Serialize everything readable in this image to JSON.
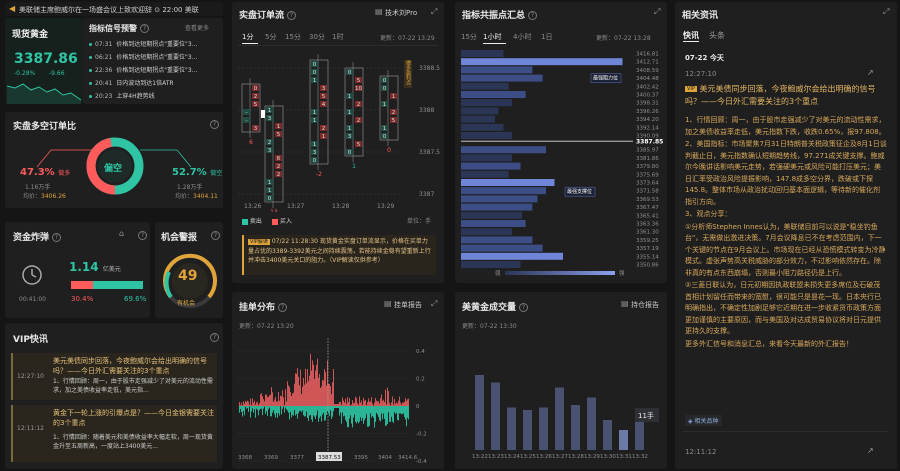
{
  "ticker": {
    "text": "美联储主席鲍威尔在一场盛会议上致欢迎辞 ⊙ 22:00 美联"
  },
  "gold": {
    "title": "现货黄金",
    "price": "3387.86",
    "change": "-0.28%",
    "change_abs": "-9.66"
  },
  "signals": {
    "title": "指标信号预警",
    "more": "查看更多",
    "items": [
      {
        "time": "07:31",
        "text": "价格到达短期拐点\"重要位\"3..."
      },
      {
        "time": "06:21",
        "text": "价格到达短期拐点\"重要位\"3..."
      },
      {
        "time": "22:36",
        "text": "价格到达短期拐点\"重要位\"3..."
      },
      {
        "time": "20:41",
        "text": "日内波动到达1倍ATR"
      },
      {
        "time": "20:23",
        "text": "上穿4H趋势线"
      }
    ]
  },
  "position": {
    "title": "实盘多空订单比",
    "center": "偏空",
    "left_pct": "47.3%",
    "left_label": "做多",
    "left_amt": "1.16万手",
    "left_avg_label": "均价：",
    "left_avg": "3406.26",
    "right_pct": "52.7%",
    "right_label": "做空",
    "right_amt": "1.28万手",
    "right_avg_label": "均价：",
    "right_avg": "3404.11"
  },
  "bomb": {
    "title": "资金炸弹",
    "value": "1.14",
    "unit": "亿美元",
    "timer": "00:41:00",
    "red_pct": "30.4%",
    "green_pct": "69.6%",
    "red_frac": 0.304
  },
  "alert": {
    "title": "机会警报",
    "score": "49",
    "label": "有机会"
  },
  "vip_news": {
    "title": "VIP快讯",
    "items": [
      {
        "time": "12:27:10",
        "text": "美元美债同步回落，今夜鲍威尔会给出明确的信号吗？——今日外汇需要关注的3个重点",
        "body": "1、行情回顾：周一，由于股市走强减少了对美元的流动性需求，加之美债收益率走低，美元指..."
      },
      {
        "time": "12:11:12",
        "text": "黄金下一轮上涨的引爆点是？——今日金银需要关注的3个重点",
        "body": "1、行情回顾：随着美元和美债收益率大幅走软，周一现货黄金升至五周新高，一度站上3400美元..."
      }
    ]
  },
  "orderflow": {
    "title": "实盘订单流",
    "link": "技术刘Pro",
    "tabs": [
      "1分",
      "5分",
      "15分",
      "30分",
      "1时"
    ],
    "updated": "更新：07-22 13:29",
    "prices": [
      "3388.5",
      "3388",
      "3387.5",
      "3387"
    ],
    "times": [
      "13:26",
      "13:27",
      "13:28",
      "13:29"
    ],
    "legend_sell": "卖出",
    "legend_buy": "买入",
    "unit_label": "单位：手",
    "delta_labels": [
      "6",
      "13",
      "-2",
      "1",
      "0"
    ],
    "side_label": "做多盈利点",
    "cols": [
      [
        "0",
        "2",
        "5",
        "-",
        "-",
        "3"
      ],
      [
        "1",
        "3",
        "1",
        "5",
        "2",
        "3",
        "6",
        "2",
        "2",
        "1",
        "1",
        "0"
      ],
      [
        "0",
        "0",
        "1",
        "3",
        "5",
        "4",
        "1",
        "1",
        "2",
        "1",
        "1",
        "3",
        "0"
      ],
      [
        "0",
        "5",
        "10",
        "1",
        "2",
        "1",
        "2",
        "1",
        "3",
        "5",
        "0"
      ],
      [
        "0",
        "0",
        "1",
        "1",
        "2",
        "5",
        "1",
        "0"
      ]
    ],
    "note_tag": "VIP解读",
    "note": "07/22 11:28:30 现货黄金实盘订单流显示，价格在买单力量占优的3389-3392美元之间持续震荡，若能持续金稳有望重新上行并冲击3400美元关口的阻力。（VIP解读仅供参考）"
  },
  "resonance": {
    "title": "指标共振点汇总",
    "tabs": [
      "15分",
      "1小时",
      "4小时",
      "1日"
    ],
    "updated": "更新：07-22 13:28",
    "current": "3387.85",
    "resist_label": "最强阻力位",
    "support_label": "最强支撑位",
    "legend_weak": "弱",
    "legend_strong": "强",
    "levels": [
      "3416.81",
      "3412.71",
      "3408.59",
      "3404.48",
      "3402.42",
      "3400.37",
      "3398.31",
      "3396.26",
      "3394.20",
      "3392.14",
      "3390.09",
      "3385.97",
      "3381.86",
      "3379.80",
      "3375.69",
      "3373.64",
      "3371.58",
      "3369.53",
      "3367.47",
      "3365.41",
      "3363.36",
      "3361.30",
      "3359.25",
      "3357.19",
      "3355.14",
      "3350.86"
    ],
    "values": [
      0.25,
      0.95,
      0.42,
      0.48,
      0.28,
      0.38,
      0.3,
      0.22,
      0.2,
      0.25,
      0.3,
      0.5,
      0.3,
      0.35,
      0.28,
      0.55,
      0.5,
      0.45,
      0.42,
      0.36,
      0.38,
      0.3,
      0.42,
      0.48,
      0.6,
      0.35
    ],
    "strength": [
      1,
      3,
      2,
      2,
      1,
      2,
      1,
      1,
      1,
      1,
      1,
      2,
      1,
      2,
      1,
      3,
      2,
      2,
      2,
      1,
      2,
      1,
      2,
      2,
      3,
      1
    ]
  },
  "news": {
    "title": "相关资讯",
    "tabs": [
      "快讯",
      "头条"
    ],
    "date": "07-22 今天",
    "items": [
      {
        "time": "12:27:10",
        "vip": "VIP",
        "title": "美元美债同步回落，今夜鲍威尔会给出明确的信号吗？——今日外汇需要关注的3个重点",
        "body": [
          "1、行情回顾：周一，由于股市走强减少了对美元的流动性需求，加之美债收益率走低，美元指数下跌，收跌0.65%，报97.808。",
          "2、美国指标：市场聚焦7月31日特朗普关税政策征企及8月1日谈判截止日，美元指数确认短期趋势线，97.271成关键支撑。鲍威尔今晚讲话影响美元走势，若强硬美元或风险可能打压美元；美日汇率受政治风险提振影响，147.8成多空分界，跌破或下探145.8。整体市场从政治扰动回归基本面逻辑，等待新的催化剂指引方向。",
          "3、观点分享：",
          "①分析师Stephen Innes认为，美联储目前可以说是\"稳坐钓鱼台\"，无需做出激进决策。7月会议降息已不在考虑范围内，下一个关键的节点在9月会议上。市场现在已经从恐慌模式转变为冷静模式。虚张声势高关税威胁的部分效力，不过影响依然存在。除非真的有点东西崩塌，否则最小阻力路径仍是上行。",
          "②三菱日联认为，日元初期因执政联盟未损失更多席位及石破茂首相计划留任而带来的宽慰，很可能只是昙花一现。日本央行已明确指出，不确定性加剧足够它近期在进一步收紧货币政策方面更加谨慎的主要原因，而与美国及对达成贸易协议将对日元提供更持久的支撑。",
          "更多外汇信号和消息汇总，来看今天最新的外汇报告！"
        ],
        "related": "相关品种"
      },
      {
        "time": "12:11:12"
      }
    ]
  },
  "hangdist": {
    "title": "挂单分布",
    "link": "挂单报告",
    "updated": "更新：07-22 13:20",
    "xticks": [
      "3368",
      "3369",
      "3377",
      "",
      "",
      "3387.53",
      "3395",
      "3404",
      "3414.6"
    ],
    "cursor_label": "3387.53",
    "yticks": [
      "0.4",
      "0.2",
      "0",
      "-0.2",
      "-0.4"
    ]
  },
  "cot": {
    "title": "美黄金成交量",
    "link": "持仓报告",
    "updated": "更新：07-22 13:30",
    "categories": [
      "13:22",
      "13:23",
      "13:24",
      "13:25",
      "13:26",
      "13:27",
      "13:28",
      "13:29",
      "13:30",
      "13:31",
      "13:32"
    ],
    "values": [
      30,
      27,
      17,
      16,
      17,
      25,
      18,
      21,
      12,
      8,
      12
    ],
    "badge": "11手"
  }
}
